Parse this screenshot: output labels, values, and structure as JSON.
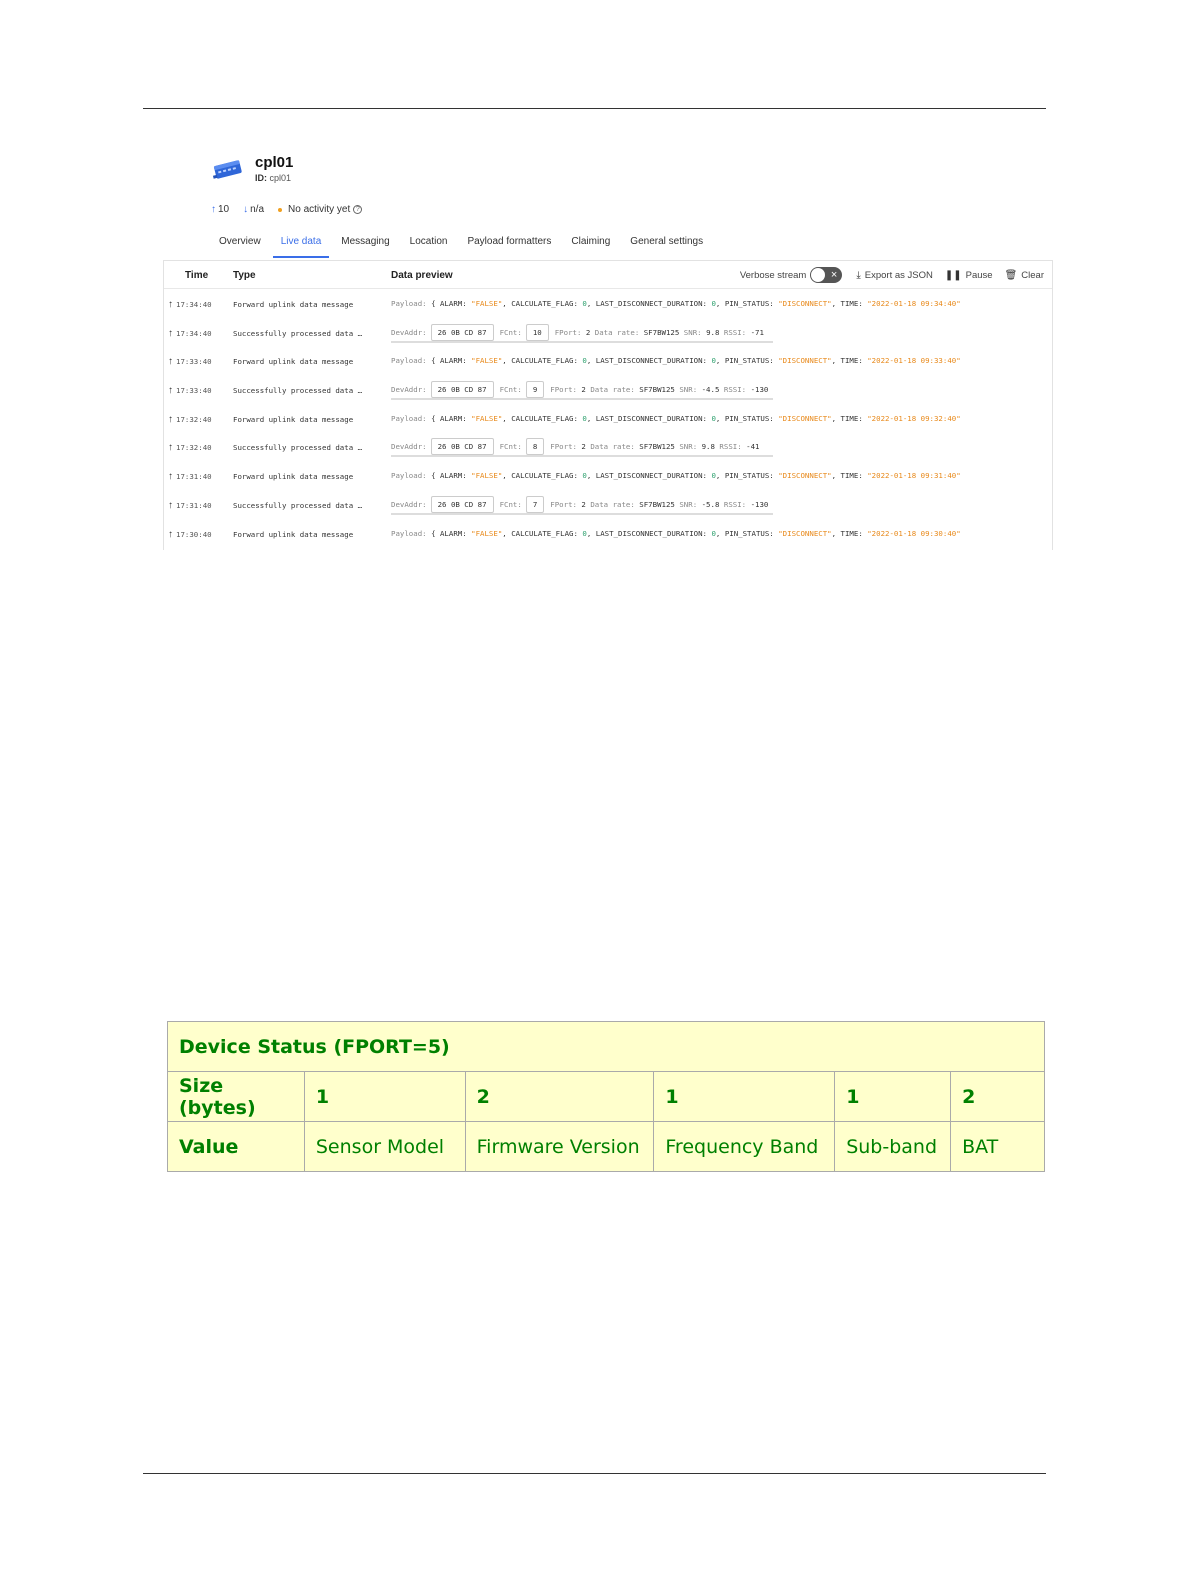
{
  "device": {
    "name": "cpl01",
    "id_label": "ID:",
    "id_value": "cpl01"
  },
  "stats": {
    "uplink": "10",
    "downlink": "n/a",
    "activity": "No activity yet"
  },
  "tabs": [
    "Overview",
    "Live data",
    "Messaging",
    "Location",
    "Payload formatters",
    "Claiming",
    "General settings"
  ],
  "active_tab": "Live data",
  "stream": {
    "columns": {
      "time": "Time",
      "type": "Type",
      "preview": "Data preview"
    },
    "toolbar": {
      "verbose": "Verbose stream",
      "export": "Export as JSON",
      "pause": "Pause",
      "clear": "Clear"
    },
    "rows": [
      {
        "time": "17:34:40",
        "type": "Forward uplink data message",
        "kind": "payload",
        "payload_time": "\"2022-01-18 09:34:40\""
      },
      {
        "time": "17:34:40",
        "type": "Successfully processed data …",
        "kind": "meta",
        "devaddr": "26 0B CD 87",
        "fcnt": "10",
        "fport": "2",
        "datarate": "SF7BW125",
        "snr": "9.8",
        "rssi": "-71"
      },
      {
        "time": "17:33:40",
        "type": "Forward uplink data message",
        "kind": "payload",
        "payload_time": "\"2022-01-18 09:33:40\""
      },
      {
        "time": "17:33:40",
        "type": "Successfully processed data …",
        "kind": "meta",
        "devaddr": "26 0B CD 87",
        "fcnt": "9",
        "fport": "2",
        "datarate": "SF7BW125",
        "snr": "-4.5",
        "rssi": "-130"
      },
      {
        "time": "17:32:40",
        "type": "Forward uplink data message",
        "kind": "payload",
        "payload_time": "\"2022-01-18 09:32:40\""
      },
      {
        "time": "17:32:40",
        "type": "Successfully processed data …",
        "kind": "meta",
        "devaddr": "26 0B CD 87",
        "fcnt": "8",
        "fport": "2",
        "datarate": "SF7BW125",
        "snr": "9.8",
        "rssi": "-41"
      },
      {
        "time": "17:31:40",
        "type": "Forward uplink data message",
        "kind": "payload",
        "payload_time": "\"2022-01-18 09:31:40\""
      },
      {
        "time": "17:31:40",
        "type": "Successfully processed data …",
        "kind": "meta",
        "devaddr": "26 0B CD 87",
        "fcnt": "7",
        "fport": "2",
        "datarate": "SF7BW125",
        "snr": "-5.8",
        "rssi": "-130"
      },
      {
        "time": "17:30:40",
        "type": "Forward uplink data message",
        "kind": "payload",
        "payload_time": "\"2022-01-18 09:30:40\""
      }
    ],
    "payload_fields": {
      "prefix": "Payload:",
      "open": "{",
      "alarm_key": "ALARM:",
      "alarm_val": "\"FALSE\"",
      "flag_key": "CALCULATE_FLAG:",
      "flag_val": "0",
      "dur_key": "LAST_DISCONNECT_DURATION:",
      "dur_val": "0",
      "pin_key": "PIN_STATUS:",
      "pin_val": "\"DISCONNECT\"",
      "time_key": "TIME:"
    },
    "meta_labels": {
      "devaddr": "DevAddr:",
      "fcnt": "FCnt:",
      "fport": "FPort:",
      "datarate": "Data rate:",
      "snr": "SNR:",
      "rssi": "RSSI:"
    }
  },
  "device_status_table": {
    "title": "Device Status (FPORT=5)",
    "size_label": "Size (bytes)",
    "sizes": [
      "1",
      "2",
      "1",
      "1",
      "2"
    ],
    "value_label": "Value",
    "values": [
      "Sensor Model",
      "Firmware Version",
      "Frequency Band",
      "Sub-band",
      "BAT"
    ]
  }
}
